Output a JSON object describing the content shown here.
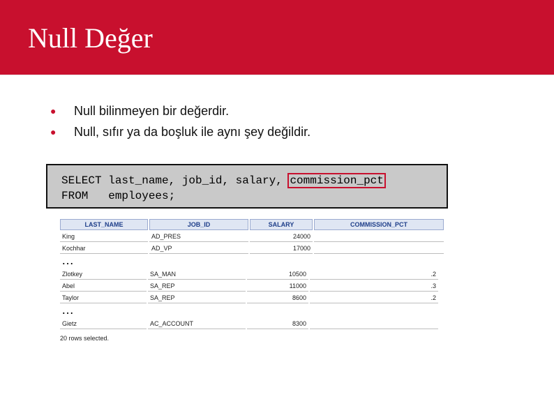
{
  "slide": {
    "title": "Null Değer",
    "bullets": [
      "Null bilinmeyen bir değerdir.",
      "Null, sıfır ya da boşluk ile aynı şey değildir."
    ],
    "sql": {
      "line1_before": "SELECT last_name, job_id, salary, ",
      "line1_highlight": "commission_pct",
      "line2": "FROM   employees;"
    }
  },
  "result": {
    "columns": [
      "LAST_NAME",
      "JOB_ID",
      "SALARY",
      "COMMISSION_PCT"
    ],
    "group1": [
      [
        "King",
        "AD_PRES",
        "24000",
        ""
      ],
      [
        "Kochhar",
        "AD_VP",
        "17000",
        ""
      ]
    ],
    "group2": [
      [
        "Zlotkey",
        "SA_MAN",
        "10500",
        ".2"
      ],
      [
        "Abel",
        "SA_REP",
        "11000",
        ".3"
      ],
      [
        "Taylor",
        "SA_REP",
        "8600",
        ".2"
      ]
    ],
    "group3": [
      [
        "Gietz",
        "AC_ACCOUNT",
        "8300",
        ""
      ]
    ],
    "ellipsis": "…",
    "footer": "20 rows selected."
  },
  "colors": {
    "title_bar": "#c8102e",
    "bullet": "#c8102e",
    "sql_background": "#c9c9c9"
  }
}
